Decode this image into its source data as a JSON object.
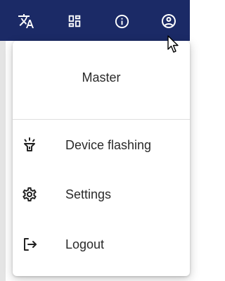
{
  "topbar": {
    "background": "#1b2a66",
    "icons": [
      "translate-icon",
      "dashboard-icon",
      "info-icon",
      "account-icon"
    ]
  },
  "menu": {
    "header": "Master",
    "items": [
      {
        "label": "Device flashing",
        "icon": "flashlight-icon"
      },
      {
        "label": "Settings",
        "icon": "gear-icon"
      },
      {
        "label": "Logout",
        "icon": "logout-icon"
      }
    ]
  }
}
